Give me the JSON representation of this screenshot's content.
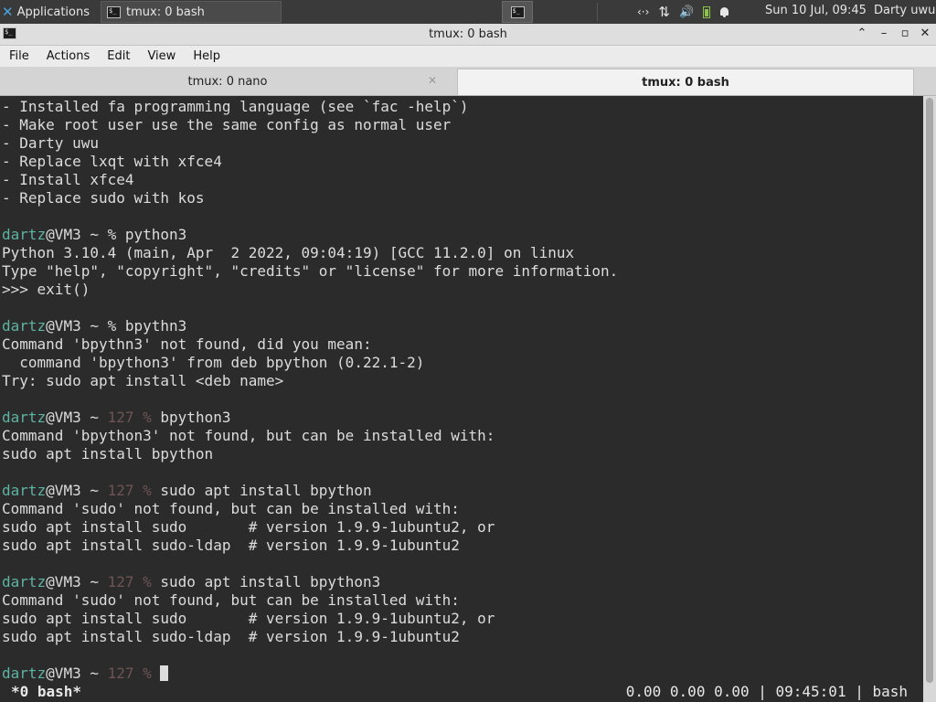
{
  "panel": {
    "applications_label": "Applications",
    "task_title": "tmux: 0 bash",
    "tray": {
      "network": "‹·›",
      "arrows": "⇅",
      "volume": "🔊",
      "battery_fraction": 0.75
    },
    "clock": "Sun 10 Jul, 09:45",
    "user": "Darty uwu"
  },
  "window": {
    "title": "tmux: 0 bash",
    "controls": {
      "up": "⌃",
      "minimize": "–",
      "maximize": "▫",
      "close": "✕"
    }
  },
  "menu": [
    "File",
    "Actions",
    "Edit",
    "View",
    "Help"
  ],
  "tabs": [
    {
      "label": "tmux: 0 nano",
      "active": false
    },
    {
      "label": "tmux: 0 bash",
      "active": true
    }
  ],
  "terminal": {
    "user": "dartz",
    "host": "VM3",
    "lines": [
      {
        "kind": "text",
        "text": "- Installed fa programming language (see `fac -help`)"
      },
      {
        "kind": "text",
        "text": "- Make root user use the same config as normal user"
      },
      {
        "kind": "text",
        "text": "- Darty uwu"
      },
      {
        "kind": "text",
        "text": "- Replace lxqt with xfce4"
      },
      {
        "kind": "text",
        "text": "- Install xfce4"
      },
      {
        "kind": "text",
        "text": "- Replace sudo with kos"
      },
      {
        "kind": "blank"
      },
      {
        "kind": "prompt",
        "status": "",
        "cmd": "python3"
      },
      {
        "kind": "text",
        "text": "Python 3.10.4 (main, Apr  2 2022, 09:04:19) [GCC 11.2.0] on linux"
      },
      {
        "kind": "text",
        "text": "Type \"help\", \"copyright\", \"credits\" or \"license\" for more information."
      },
      {
        "kind": "text",
        "text": ">>> exit()"
      },
      {
        "kind": "blank"
      },
      {
        "kind": "prompt",
        "status": "",
        "cmd": "bpythn3"
      },
      {
        "kind": "text",
        "text": "Command 'bpythn3' not found, did you mean:"
      },
      {
        "kind": "text",
        "text": "  command 'bpython3' from deb bpython (0.22.1-2)"
      },
      {
        "kind": "text",
        "text": "Try: sudo apt install <deb name>"
      },
      {
        "kind": "blank"
      },
      {
        "kind": "prompt",
        "status": "127",
        "cmd": "bpython3"
      },
      {
        "kind": "text",
        "text": "Command 'bpython3' not found, but can be installed with:"
      },
      {
        "kind": "text",
        "text": "sudo apt install bpython"
      },
      {
        "kind": "blank"
      },
      {
        "kind": "prompt",
        "status": "127",
        "cmd": "sudo apt install bpython"
      },
      {
        "kind": "text",
        "text": "Command 'sudo' not found, but can be installed with:"
      },
      {
        "kind": "text",
        "text": "sudo apt install sudo       # version 1.9.9-1ubuntu2, or"
      },
      {
        "kind": "text",
        "text": "sudo apt install sudo-ldap  # version 1.9.9-1ubuntu2"
      },
      {
        "kind": "blank"
      },
      {
        "kind": "prompt",
        "status": "127",
        "cmd": "sudo apt install bpython3"
      },
      {
        "kind": "text",
        "text": "Command 'sudo' not found, but can be installed with:"
      },
      {
        "kind": "text",
        "text": "sudo apt install sudo       # version 1.9.9-1ubuntu2, or"
      },
      {
        "kind": "text",
        "text": "sudo apt install sudo-ldap  # version 1.9.9-1ubuntu2"
      },
      {
        "kind": "blank"
      },
      {
        "kind": "prompt",
        "status": "127",
        "cmd": "",
        "cursor": true
      }
    ]
  },
  "tmux_status": {
    "left": "*0 bash*",
    "right": "0.00 0.00 0.00 | 09:45:01 | bash"
  },
  "colors": {
    "terminal_bg": "#2b2b2b",
    "terminal_fg": "#dcdcdc",
    "prompt_user": "#5fb3a1",
    "exit_status": "#6e5454"
  }
}
